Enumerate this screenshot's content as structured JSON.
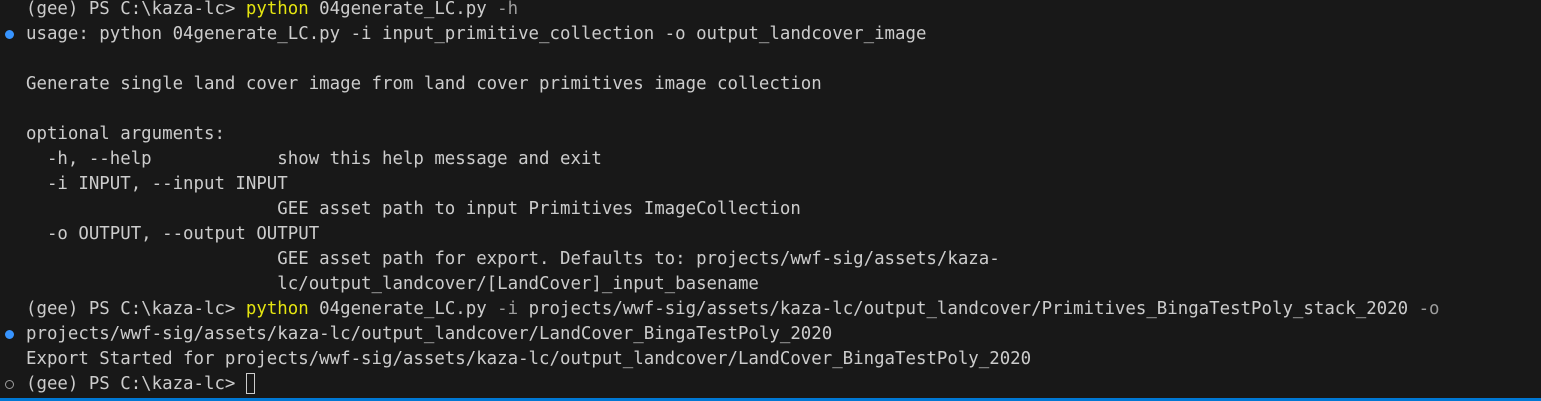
{
  "prompt": "(gee) PS C:\\kaza-lc> ",
  "command1": {
    "exe": "python",
    "script": " 04generate_LC.py ",
    "flag": "-h"
  },
  "help": {
    "usage": "usage: python 04generate_LC.py -i input_primitive_collection -o output_landcover_image",
    "description": "Generate single land cover image from land cover primitives image collection",
    "section": "optional arguments:",
    "opt_h": "  -h, --help            show this help message and exit",
    "opt_i": "  -i INPUT, --input INPUT",
    "opt_i_desc": "                        GEE asset path to input Primitives ImageCollection",
    "opt_o": "  -o OUTPUT, --output OUTPUT",
    "opt_o_desc1": "                        GEE asset path for export. Defaults to: projects/wwf-sig/assets/kaza-",
    "opt_o_desc2": "                        lc/output_landcover/[LandCover]_input_basename"
  },
  "command2": {
    "exe": "python",
    "script": " 04generate_LC.py ",
    "flag_i": "-i",
    "input_path": " projects/wwf-sig/assets/kaza-lc/output_landcover/Primitives_BingaTestPoly_stack_2020 ",
    "flag_o": "-o",
    "output_path": "projects/wwf-sig/assets/kaza-lc/output_landcover/LandCover_BingaTestPoly_2020"
  },
  "result": "Export Started for projects/wwf-sig/assets/kaza-lc/output_landcover/LandCover_BingaTestPoly_2020",
  "colors": {
    "background": "#181818",
    "text": "#cccccc",
    "command": "#e5e510",
    "flag": "#9d9d9d",
    "success_marker": "#3794ff",
    "panel_border": "#0078d4"
  },
  "icons": {
    "success": "command-success-dot-icon",
    "pending": "command-pending-circle-icon"
  }
}
